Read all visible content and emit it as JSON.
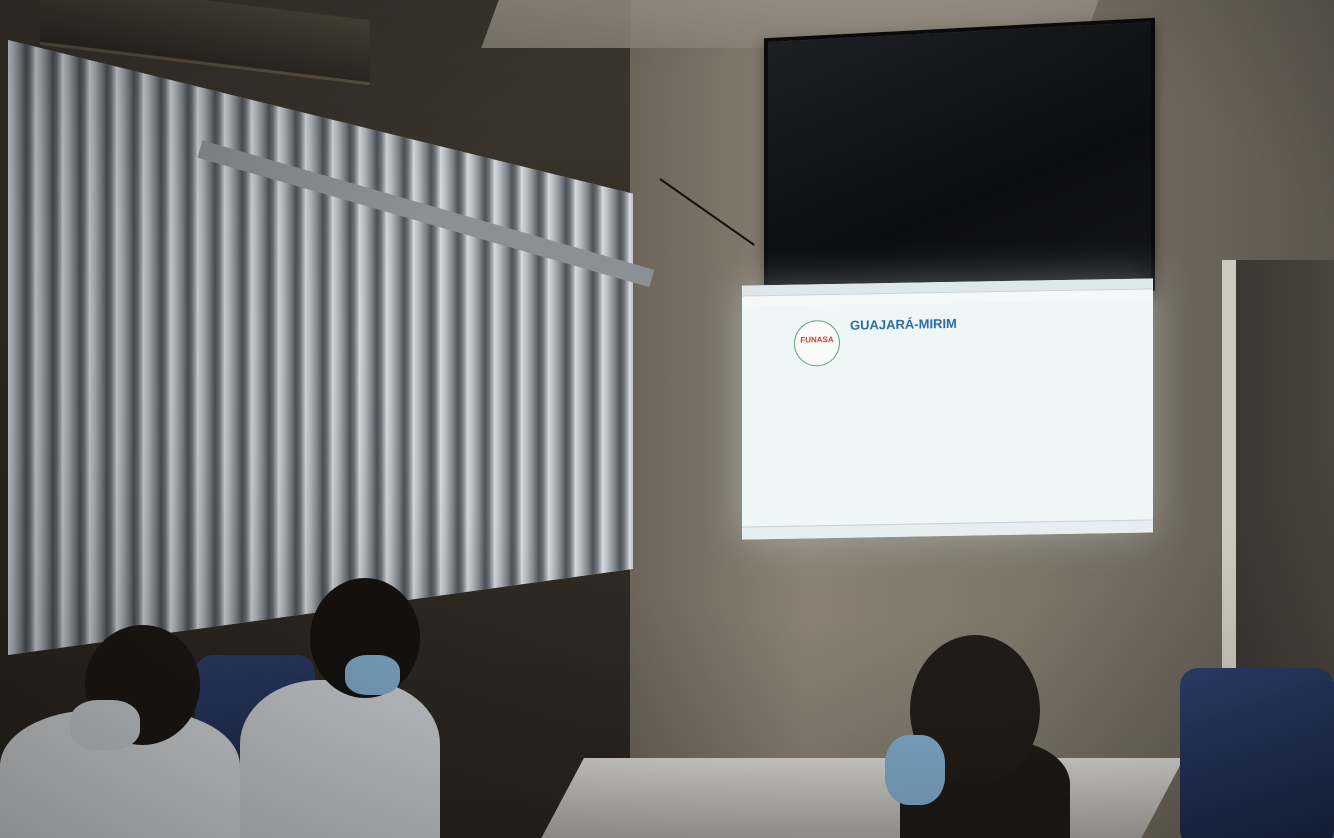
{
  "projection": {
    "logo_text": "FUNASA",
    "title": "GUAJARÁ-MIRIM"
  },
  "colors": {
    "projection_bg": "#eef7f6",
    "title_blue": "#2b6da8",
    "logo_red": "#d13b32"
  }
}
